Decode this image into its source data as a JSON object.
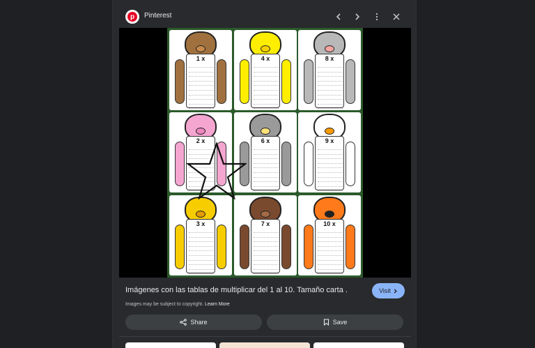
{
  "header": {
    "source_name": "Pinterest",
    "logo_letter": "p",
    "icons": [
      "pinterest-logo-icon",
      "chevron-left-icon",
      "chevron-right-icon",
      "more-vert-icon",
      "close-icon"
    ]
  },
  "image": {
    "tables": [
      {
        "title": "1 x",
        "animal": "monkey",
        "color": "#a0713f",
        "accent": "#c98a4b"
      },
      {
        "title": "4 x",
        "animal": "chick",
        "color": "#ffee00",
        "accent": "#f7d000"
      },
      {
        "title": "8 x",
        "animal": "elephant",
        "color": "#b8b8b8",
        "accent": "#f2a6a0"
      },
      {
        "title": "2 x",
        "animal": "pig",
        "color": "#f5a6d0",
        "accent": "#ec86be"
      },
      {
        "title": "6 x",
        "animal": "donkey",
        "color": "#9a9a9a",
        "accent": "#ffe27a"
      },
      {
        "title": "9 x",
        "animal": "duck",
        "color": "#ffffff",
        "accent": "#ff9a00"
      },
      {
        "title": "3 x",
        "animal": "lion",
        "color": "#f7cd00",
        "accent": "#e39b00"
      },
      {
        "title": "7 x",
        "animal": "cow",
        "color": "#7a4a2e",
        "accent": "#a36a45"
      },
      {
        "title": "10 x",
        "animal": "tiger",
        "color": "#ff7a1a",
        "accent": "#222222"
      }
    ],
    "overlay": "star-outline"
  },
  "caption": {
    "title": "Imágenes con las tablas de multiplicar del 1 al 10. Tamaño carta ...",
    "visit_label": "Visit",
    "copyright_text": "Images may be subject to copyright.",
    "learn_more": "Learn More"
  },
  "actions": {
    "share_label": "Share",
    "save_label": "Save"
  },
  "colors": {
    "background": "#1f2023",
    "panel": "#292a2d",
    "visit_button": "#8ab4f8",
    "action_button": "#3c4043",
    "poster_border": "#2b5a2b"
  }
}
